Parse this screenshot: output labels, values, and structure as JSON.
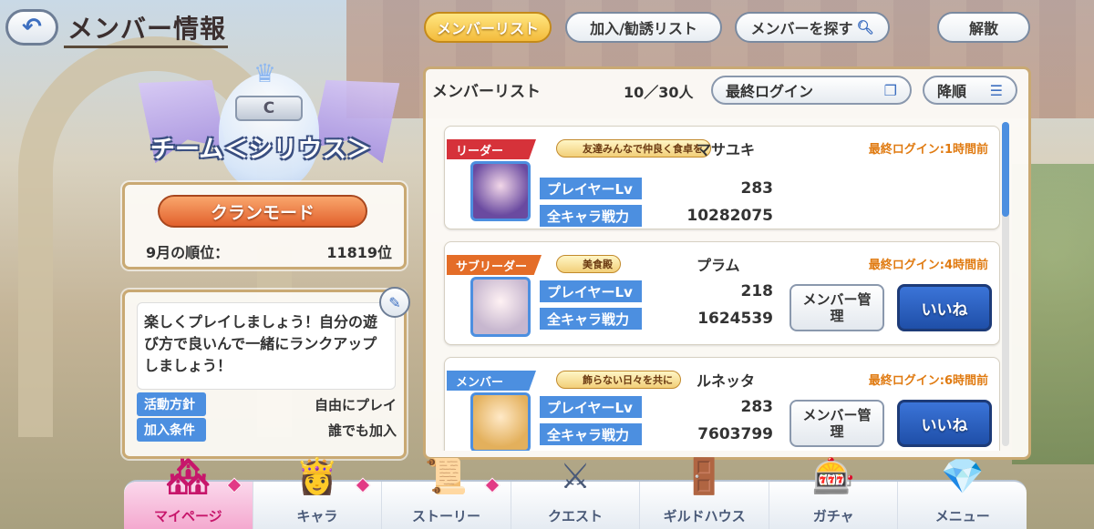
{
  "header": {
    "title": "メンバー情報",
    "back_icon": "back-arrow-icon",
    "tabs": [
      {
        "label": "メンバーリスト",
        "active": true
      },
      {
        "label": "加入/勧誘リスト",
        "active": false
      },
      {
        "label": "メンバーを探す",
        "active": false
      },
      {
        "label": "解散",
        "active": false
      }
    ]
  },
  "clan": {
    "rank_badge": "C",
    "name": "チーム＜シリウス＞",
    "mode_button": "クランモード",
    "rank_label": "9月の順位：",
    "rank_value": "11819位",
    "description": "楽しくプレイしましょう！自分の遊び方で良いんで一緒にランクアップしましょう！",
    "policy_label": "活動方針",
    "policy_value": "自由にプレイ",
    "join_label": "加入条件",
    "join_value": "誰でも加入"
  },
  "member_list": {
    "title": "メンバーリスト",
    "count": "10／30人",
    "sort": "最終ログイン",
    "order": "降順",
    "members": [
      {
        "role": "リーダー",
        "title_tag": "友達みんなで仲良く食卓を",
        "name": "マサユキ",
        "last_login": "最終ログイン:1時間前",
        "level_label": "プレイヤーLv",
        "level": "283",
        "power_label": "全キャラ戦力",
        "power": "10282075"
      },
      {
        "role": "サブリーダー",
        "title_tag": "美食殿",
        "name": "プラム",
        "last_login": "最終ログイン:4時間前",
        "level_label": "プレイヤーLv",
        "level": "218",
        "power_label": "全キャラ戦力",
        "power": "1624539",
        "manage_button": "メンバー管理",
        "like_button": "いいね"
      },
      {
        "role": "メンバー",
        "title_tag": "飾らない日々を共に",
        "name": "ルネッタ",
        "last_login": "最終ログイン:6時間前",
        "level_label": "プレイヤーLv",
        "level": "283",
        "power_label": "全キャラ戦力",
        "power": "7603799",
        "manage_button": "メンバー管理",
        "like_button": "いいね"
      }
    ]
  },
  "bottom_nav": [
    {
      "label": "マイページ",
      "icon": "my-page-icon",
      "active": true
    },
    {
      "label": "キャラ",
      "icon": "character-icon",
      "active": false
    },
    {
      "label": "ストーリー",
      "icon": "story-scroll-icon",
      "active": false
    },
    {
      "label": "クエスト",
      "icon": "quest-sword-icon",
      "active": false
    },
    {
      "label": "ギルドハウス",
      "icon": "guild-house-icon",
      "active": false
    },
    {
      "label": "ガチャ",
      "icon": "gacha-icon",
      "active": false
    },
    {
      "label": "メニュー",
      "icon": "menu-crystal-icon",
      "active": false
    }
  ],
  "colors": {
    "accent_blue": "#4c8fe0",
    "leader_red": "#d6323a",
    "subleader_orange": "#e46d28",
    "login_orange": "#e07b12",
    "active_tab_gold": "#f3bb3c"
  }
}
